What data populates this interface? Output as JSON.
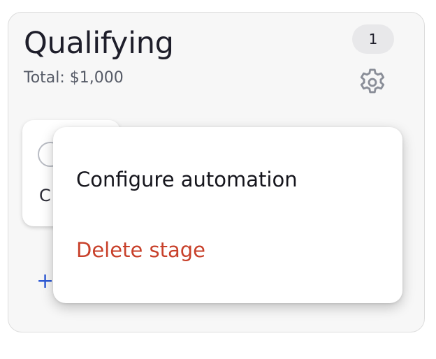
{
  "stage": {
    "title": "Qualifying",
    "total": "Total: $1,000",
    "count": "1"
  },
  "deal_card": {
    "initial": "C"
  },
  "add_deal": {
    "glyph": "+"
  },
  "menu": {
    "items": [
      {
        "label": "Configure automation",
        "color": "#15151c"
      },
      {
        "label": "Delete stage",
        "color": "#c8402a"
      }
    ]
  },
  "icons": {
    "settings": "gear-icon",
    "add": "plus-icon"
  },
  "colors": {
    "card_background": "#f7f7f7",
    "badge_background": "#e8e8ea",
    "danger": "#c8402a",
    "accent": "#2f5bd6"
  }
}
